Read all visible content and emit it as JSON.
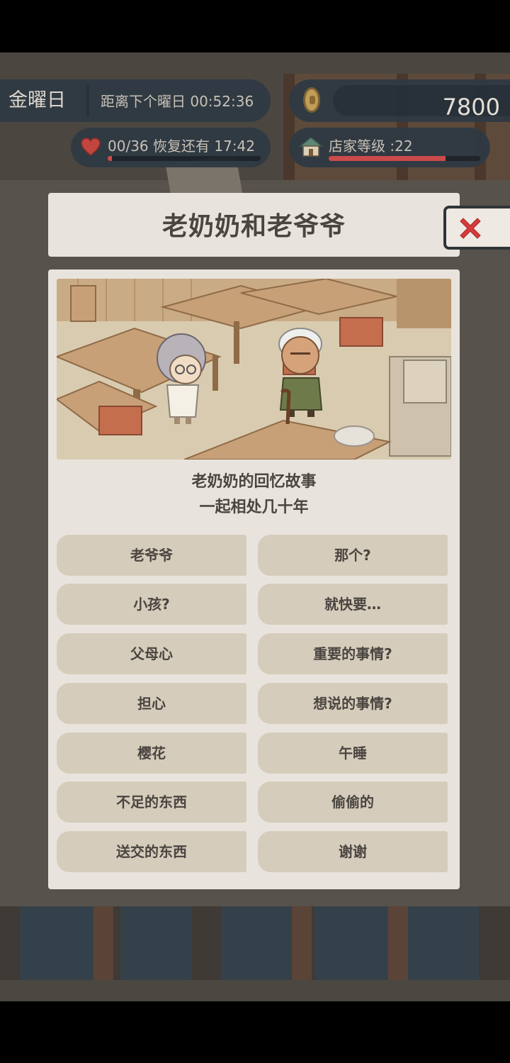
{
  "hud": {
    "day": "金曜日",
    "next_day": "距离下个曜日 00:52:36",
    "coins": "7800",
    "hearts": "00/36  恢复还有  17:42",
    "hearts_progress": 0.03,
    "shop_level": "店家等级 :22",
    "shop_progress": 0.77
  },
  "dialog": {
    "title": "老奶奶和老爷爷",
    "story_line1": "老奶奶的回忆故事",
    "story_line2": "一起相处几十年",
    "choices_left": [
      "老爷爷",
      "小孩?",
      "父母心",
      "担心",
      "樱花",
      "不足的东西",
      "送交的东西"
    ],
    "choices_right": [
      "那个?",
      "就快要…",
      "重要的事情?",
      "想说的事情?",
      "午睡",
      "偷偷的",
      "谢谢"
    ]
  },
  "icons": {
    "close": "close-x-icon",
    "heart": "heart-icon",
    "coin": "coin-icon",
    "shop": "house-icon"
  },
  "colors": {
    "accent_red": "#d24b4b",
    "panel": "#e8e4dd",
    "choice": "#d6ccbb",
    "hud": "#2f3a44"
  }
}
